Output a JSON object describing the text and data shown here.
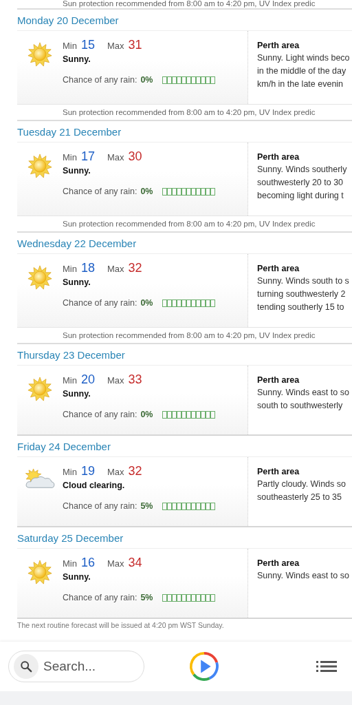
{
  "top_note": "Sun protection recommended from 8:00 am to 4:20 pm, UV Index predic",
  "days": [
    {
      "date": "Monday 20 December",
      "kind": "sunny",
      "min_label": "Min",
      "max_label": "Max",
      "min": "15",
      "max": "31",
      "summary": "Sunny.",
      "rain_label": "Chance of any rain:",
      "rain": "0%",
      "area": "Perth area",
      "detail": [
        "Sunny. Light winds beco",
        "in the middle of the day",
        "km/h in the late evenin"
      ],
      "uv": "Sun protection recommended from 8:00 am to 4:20 pm, UV Index predic"
    },
    {
      "date": "Tuesday 21 December",
      "kind": "sunny",
      "min_label": "Min",
      "max_label": "Max",
      "min": "17",
      "max": "30",
      "summary": "Sunny.",
      "rain_label": "Chance of any rain:",
      "rain": "0%",
      "area": "Perth area",
      "detail": [
        "Sunny. Winds southerly",
        "southwesterly 20 to 30",
        "becoming light during t"
      ],
      "uv": "Sun protection recommended from 8:00 am to 4:20 pm, UV Index predic"
    },
    {
      "date": "Wednesday 22 December",
      "kind": "sunny",
      "min_label": "Min",
      "max_label": "Max",
      "min": "18",
      "max": "32",
      "summary": "Sunny.",
      "rain_label": "Chance of any rain:",
      "rain": "0%",
      "area": "Perth area",
      "detail": [
        "Sunny. Winds south to s",
        "turning southwesterly 2",
        "tending southerly 15 to"
      ],
      "uv": "Sun protection recommended from 8:00 am to 4:20 pm, UV Index predic"
    },
    {
      "date": "Thursday 23 December",
      "kind": "sunny",
      "min_label": "Min",
      "max_label": "Max",
      "min": "20",
      "max": "33",
      "summary": "Sunny.",
      "rain_label": "Chance of any rain:",
      "rain": "0%",
      "area": "Perth area",
      "detail": [
        "Sunny. Winds east to so",
        "south to southwesterly"
      ]
    },
    {
      "date": "Friday 24 December",
      "kind": "cloud_clearing",
      "min_label": "Min",
      "max_label": "Max",
      "min": "19",
      "max": "32",
      "summary": "Cloud clearing.",
      "rain_label": "Chance of any rain:",
      "rain": "5%",
      "area": "Perth area",
      "detail": [
        "Partly cloudy. Winds so",
        "southeasterly 25 to 35"
      ]
    },
    {
      "date": "Saturday 25 December",
      "kind": "sunny",
      "min_label": "Min",
      "max_label": "Max",
      "min": "16",
      "max": "34",
      "summary": "Sunny.",
      "rain_label": "Chance of any rain:",
      "rain": "5%",
      "area": "Perth area",
      "detail": [
        "Sunny. Winds east to so"
      ]
    }
  ],
  "footer_note": "The next routine forecast will be issued at 4:20 pm WST Sunday.",
  "bottom_bar": {
    "search": {
      "placeholder": "Search..."
    }
  }
}
